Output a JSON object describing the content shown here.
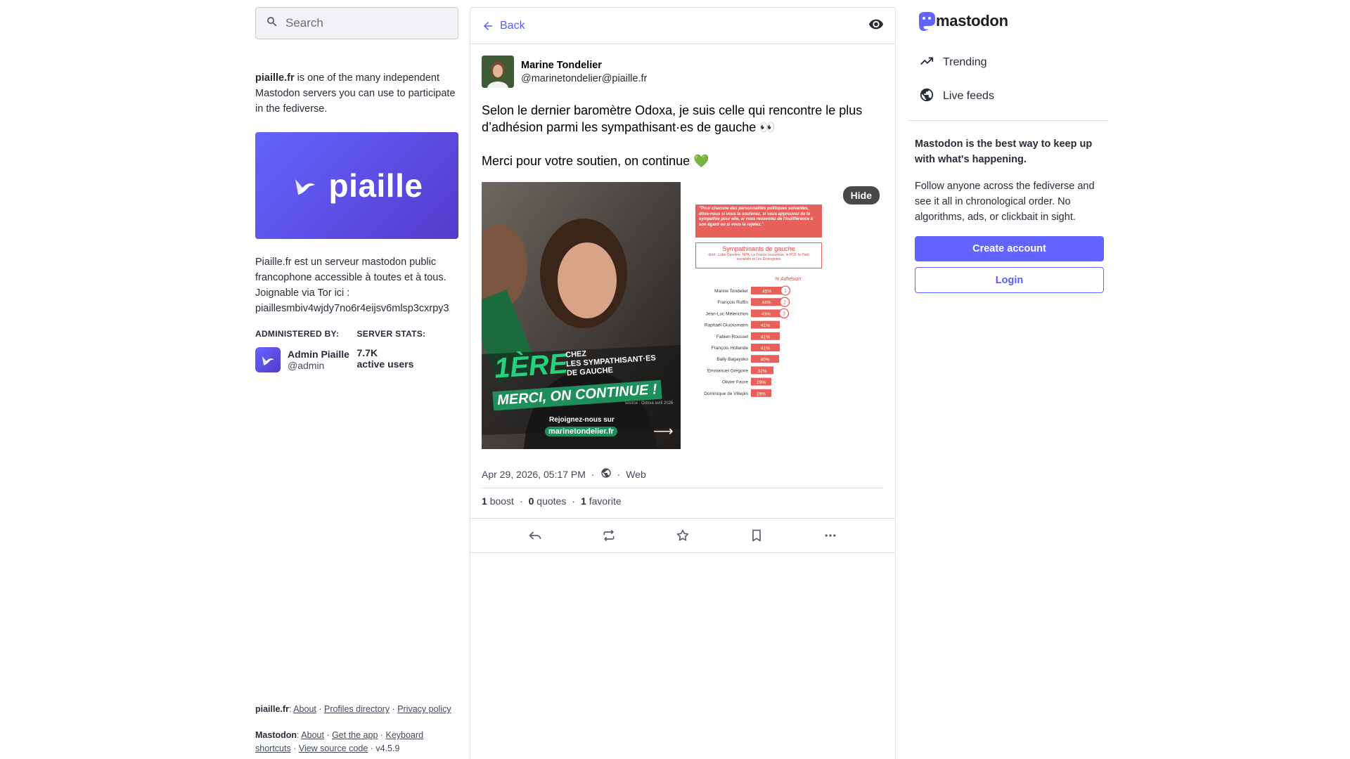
{
  "search": {
    "placeholder": "Search"
  },
  "about": {
    "server": "piaille.fr",
    "intro_rest": " is one of the many independent Mastodon servers you can use to participate in the fediverse.",
    "hero_logo_text": "piaille",
    "description_lines": [
      "Piaille.fr est un serveur mastodon public",
      "francophone accessible à toutes et à tous.",
      "Joignable via Tor ici :",
      "piaillesmbiv4wjdy7no6r4eijsv6mlsp3cxrpy3"
    ],
    "admin_heading": "ADMINISTERED BY:",
    "admin_name": "Admin Piaille",
    "admin_handle": "@admin",
    "stats_heading": "SERVER STATS:",
    "stats_value": "7.7K",
    "stats_label": "active users"
  },
  "footer": {
    "server_label": "piaille.fr",
    "server_links": [
      "About",
      "Profiles directory",
      "Privacy policy"
    ],
    "mastodon_label": "Mastodon",
    "mastodon_links": [
      "About",
      "Get the app",
      "Keyboard shortcuts",
      "View source code"
    ],
    "version": "v4.5.9"
  },
  "status": {
    "back_label": "Back",
    "author_name": "Marine Tondelier",
    "author_handle": "@marinetondelier@piaille.fr",
    "paragraph_1": "Selon le dernier baromètre Odoxa, je suis celle qui rencontre le plus d’adhésion parmi les sympathisant·es de gauche 👀",
    "paragraph_2": "Merci pour votre soutien, on continue 💚",
    "hide_label": "Hide",
    "timestamp": "Apr 29, 2026, 05:17 PM",
    "application": "Web",
    "boost_count": "1",
    "boost_label": "boost",
    "quote_count": "0",
    "quote_label": "quotes",
    "favorite_count": "1",
    "favorite_label": "favorite"
  },
  "image1": {
    "headline_big": "1ÈRE",
    "headline_small_1": "CHEZ",
    "headline_small_2": "LES SYMPATHISANT·ES",
    "headline_small_3": "DE GAUCHE",
    "banner": "MERCI, ON CONTINUE !",
    "source": "source : Odoxa avril 2026",
    "cta": "Rejoignez-nous sur",
    "site": "marinetondelier.fr",
    "arrow": "⟶"
  },
  "image2": {
    "question": "\"Pour chacune des personnalités politiques suivantes, dites-nous si vous la soutenez, si vous approuvez de la sympathie pour elle, si vous ressentez de l'indifférence à son égard ou si vous la rejetez.\"",
    "group_title": "Sympathisants de gauche",
    "group_sub": "dont : Lutte Ouvrière, NPA, La France insoumise, le PCF, le Parti socialiste et Les Écologistes",
    "col_label": "% Adhésion",
    "chart_data": {
      "type": "bar",
      "categories": [
        "Marine Tondelier",
        "François Ruffin",
        "Jean-Luc Mélenchon",
        "Raphaël Glucksmann",
        "Fabien Roussel",
        "François Hollande",
        "Bally Bagayoko",
        "Emmanuel Grégoire",
        "Olivier Faure",
        "Dominique de Villepin"
      ],
      "values": [
        45,
        44,
        43,
        41,
        41,
        41,
        40,
        32,
        29,
        29
      ],
      "ranks": [
        "1",
        "2",
        "3"
      ],
      "bar_color": "#e8605a"
    }
  },
  "right": {
    "brand": "mastodon",
    "nav": [
      {
        "label": "Trending",
        "icon": "trending-icon"
      },
      {
        "label": "Live feeds",
        "icon": "globe-icon"
      }
    ],
    "lead": "Mastodon is the best way to keep up with what's happening.",
    "text": "Follow anyone across the fediverse and see it all in chronological order. No algorithms, ads, or clickbait in sight.",
    "create_account": "Create account",
    "login": "Login"
  },
  "colors": {
    "accent": "#6364ff",
    "link": "#595aff",
    "green": "#1e8f5a"
  }
}
